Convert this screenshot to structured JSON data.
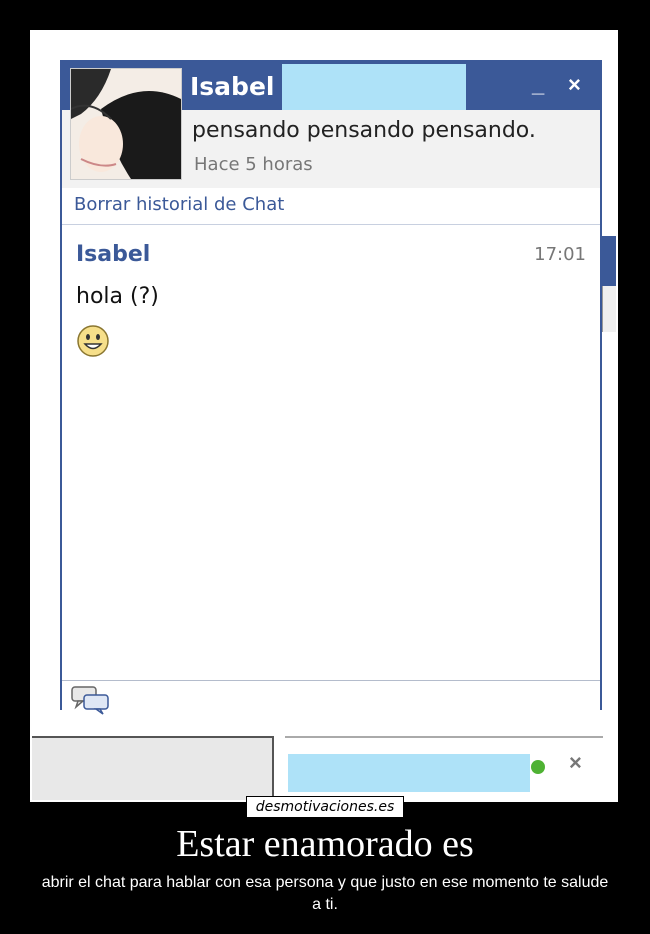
{
  "chat": {
    "contact_name": "Isabel",
    "minimize_glyph": "_",
    "close_glyph": "×",
    "status_message": "pensando pensando pensando.",
    "status_time": "Hace 5 horas",
    "clear_history": "Borrar historial de Chat",
    "messages": [
      {
        "sender": "Isabel",
        "time": "17:01",
        "text": "hola (?)",
        "emoticon": "smiley-face-icon"
      }
    ],
    "input_icon": "chat-bubbles-icon",
    "online_status_color": "#4fb233",
    "dock_close_glyph": "×"
  },
  "colors": {
    "facebook_blue": "#3b5998",
    "redaction": "#aee2f8"
  },
  "poster": {
    "watermark": "desmotivaciones.es",
    "headline": "Estar enamorado es",
    "caption": "abrir el chat para hablar con  esa persona y que justo en ese momento te salude a ti."
  }
}
